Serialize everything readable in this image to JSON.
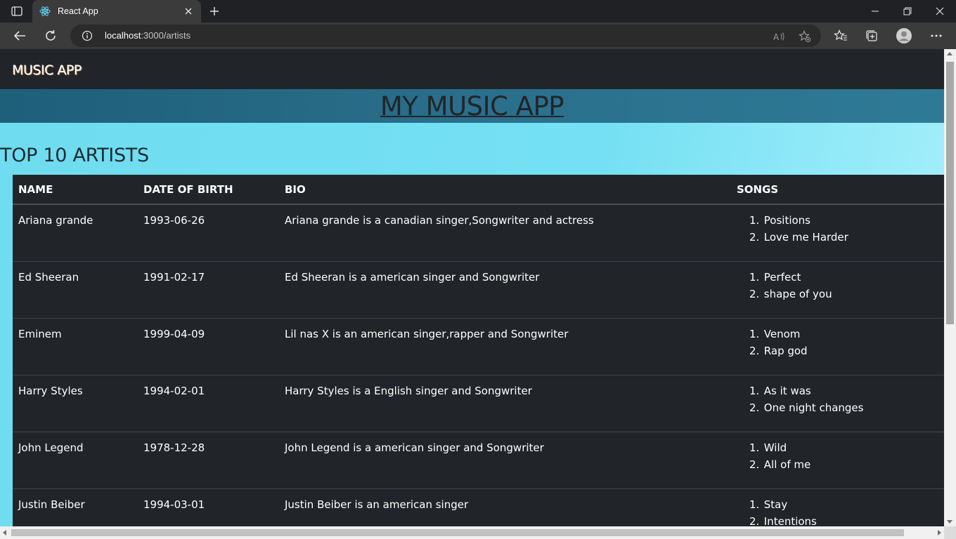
{
  "browser": {
    "tab_title": "React App",
    "url_host": "localhost",
    "url_path": ":3000/artists"
  },
  "page": {
    "brand": "MUSIC APP",
    "banner_title": "MY MUSIC APP",
    "section_title": "TOP 10 ARTISTS",
    "table": {
      "headers": [
        "NAME",
        "DATE OF BIRTH",
        "BIO",
        "SONGS"
      ],
      "rows": [
        {
          "name": "Ariana grande",
          "dob": "1993-06-26",
          "bio": "Ariana grande is a canadian singer,Songwriter and actress",
          "songs": [
            "Positions",
            "Love me Harder"
          ]
        },
        {
          "name": "Ed Sheeran",
          "dob": "1991-02-17",
          "bio": "Ed Sheeran is a american singer and Songwriter",
          "songs": [
            "Perfect",
            "shape of you"
          ]
        },
        {
          "name": "Eminem",
          "dob": "1999-04-09",
          "bio": "Lil nas X is an american singer,rapper and Songwriter",
          "songs": [
            "Venom",
            "Rap god"
          ]
        },
        {
          "name": "Harry Styles",
          "dob": "1994-02-01",
          "bio": "Harry Styles is a English singer and Songwriter",
          "songs": [
            "As it was",
            "One night changes"
          ]
        },
        {
          "name": "John Legend",
          "dob": "1978-12-28",
          "bio": "John Legend is a american singer and Songwriter",
          "songs": [
            "Wild",
            "All of me"
          ]
        },
        {
          "name": "Justin Beiber",
          "dob": "1994-03-01",
          "bio": "Justin Beiber is an american singer",
          "songs": [
            "Stay",
            "Intentions"
          ]
        }
      ]
    }
  },
  "colors": {
    "navbar": "#212529",
    "hero": "#6fdcf0",
    "banner": "#2a6f8c"
  }
}
